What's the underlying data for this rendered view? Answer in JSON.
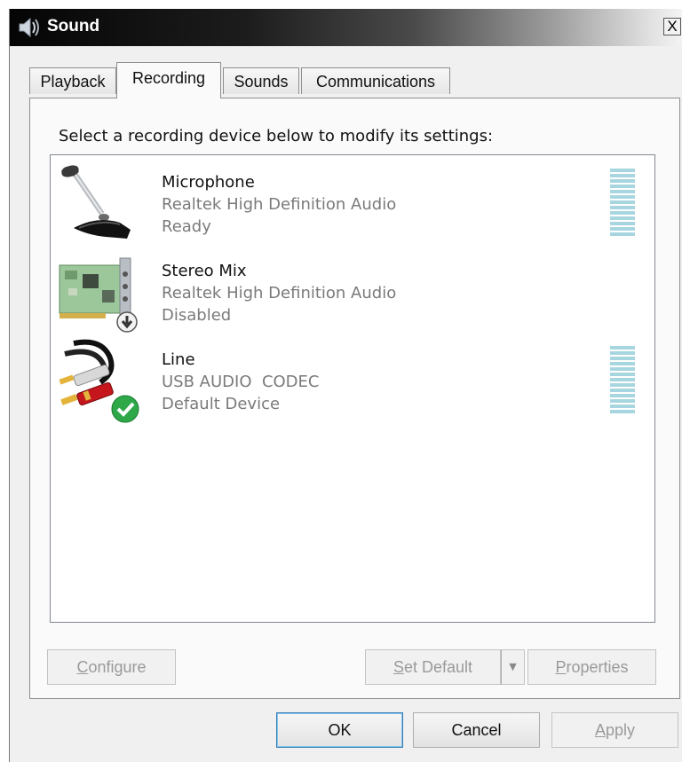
{
  "window": {
    "title": "Sound",
    "close_glyph": "X"
  },
  "tabs": [
    {
      "label": "Playback",
      "active": false
    },
    {
      "label": "Recording",
      "active": true
    },
    {
      "label": "Sounds",
      "active": false
    },
    {
      "label": "Communications",
      "active": false
    }
  ],
  "recording": {
    "instruction": "Select a recording device below to modify its settings:",
    "devices": [
      {
        "name": "Microphone",
        "driver": "Realtek High Definition Audio",
        "status": "Ready",
        "icon": "microphone-icon",
        "has_level_meter": true
      },
      {
        "name": "Stereo Mix",
        "driver": "Realtek High Definition Audio",
        "status": "Disabled",
        "icon": "sound-card-icon",
        "overlay": "disabled-arrow-icon",
        "has_level_meter": false
      },
      {
        "name": "Line",
        "driver": "USB AUDIO  CODEC",
        "status": "Default Device",
        "icon": "rca-cable-icon",
        "overlay": "green-check-icon",
        "has_level_meter": true
      }
    ]
  },
  "buttons": {
    "configure": {
      "first": "C",
      "rest": "onfigure",
      "enabled": false
    },
    "set_default": {
      "first": "S",
      "rest": "et Default",
      "enabled": false
    },
    "properties": {
      "first": "P",
      "rest": "roperties",
      "enabled": false
    },
    "ok": {
      "label": "OK",
      "enabled": true
    },
    "cancel": {
      "label": "Cancel",
      "enabled": true
    },
    "apply": {
      "first": "A",
      "rest": "pply",
      "enabled": false
    }
  },
  "colors": {
    "level_meter": "#a8d6e0",
    "check_green": "#2fa84a",
    "rca_red": "#c4161c",
    "rca_gold": "#e4b43a"
  }
}
